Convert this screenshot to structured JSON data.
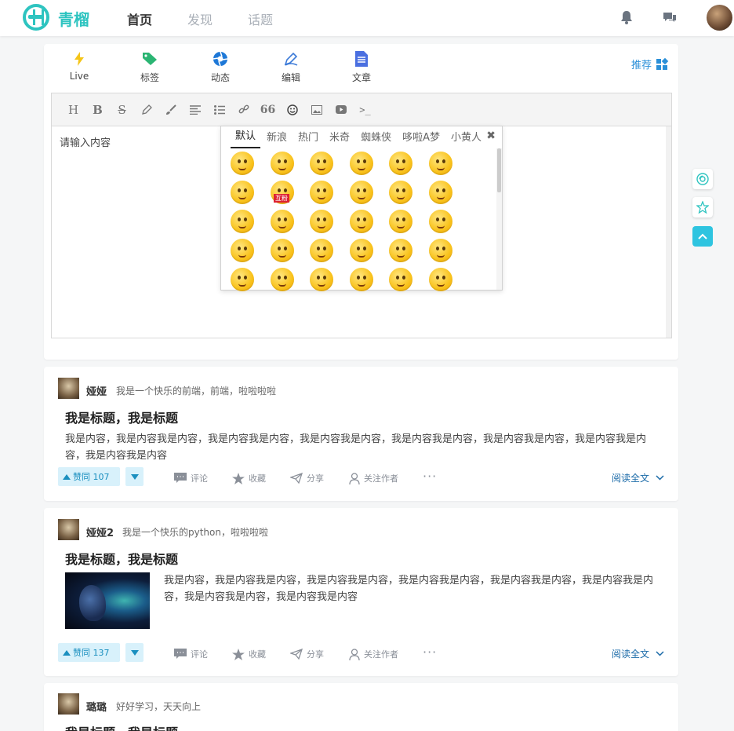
{
  "header": {
    "brand": "青榴",
    "nav": [
      "首页",
      "发现",
      "话题"
    ]
  },
  "composer": {
    "tabs": [
      {
        "label": "Live",
        "icon": "lightning-icon"
      },
      {
        "label": "标签",
        "icon": "tag-icon"
      },
      {
        "label": "动态",
        "icon": "aperture-icon"
      },
      {
        "label": "编辑",
        "icon": "pen-icon"
      },
      {
        "label": "文章",
        "icon": "document-icon"
      }
    ],
    "recommend_label": "推荐",
    "placeholder": "请输入内容",
    "toolbar": [
      "heading",
      "bold",
      "strikethrough",
      "pencil",
      "brush",
      "align",
      "list",
      "link",
      "quote",
      "emoji",
      "image",
      "video",
      "terminal"
    ],
    "toolbar_glyphs": {
      "heading": "H",
      "bold": "B",
      "strikethrough": "S",
      "quote": "66",
      "terminal": ">_"
    }
  },
  "emoji_panel": {
    "tabs": [
      "默认",
      "新浪",
      "热门",
      "米奇",
      "蜘蛛侠",
      "哆啦A梦",
      "小黄人"
    ],
    "active_tab": "默认",
    "close_glyph": "✖",
    "overlay_label": "互粉"
  },
  "posts": [
    {
      "author": "娅娅",
      "bio": "我是一个快乐的前端，前端，啦啦啦啦",
      "title": "我是标题，我是标题",
      "body": "我是内容，我是内容我是内容，我是内容我是内容，我是内容我是内容，我是内容我是内容，我是内容我是内容，我是内容我是内容，我是内容我是内容",
      "votes": "赞同 107",
      "actions": [
        "评论",
        "收藏",
        "分享",
        "关注作者"
      ],
      "read_more": "阅读全文"
    },
    {
      "author": "娅娅2",
      "bio": "我是一个快乐的python，啦啦啦啦",
      "title": "我是标题，我是标题",
      "body": "我是内容，我是内容我是内容，我是内容我是内容，我是内容我是内容，我是内容我是内容，我是内容我是内容，我是内容我是内容，我是内容我是内容",
      "votes": "赞同 137",
      "actions": [
        "评论",
        "收藏",
        "分享",
        "关注作者"
      ],
      "read_more": "阅读全文"
    },
    {
      "author": "璐璐",
      "bio": "好好学习，天天向上",
      "title": "我是标题，我是标题"
    }
  ],
  "colors": {
    "brand": "#2ec4c0",
    "link": "#2a8fd8",
    "vote_bg": "#d8f1fb"
  }
}
